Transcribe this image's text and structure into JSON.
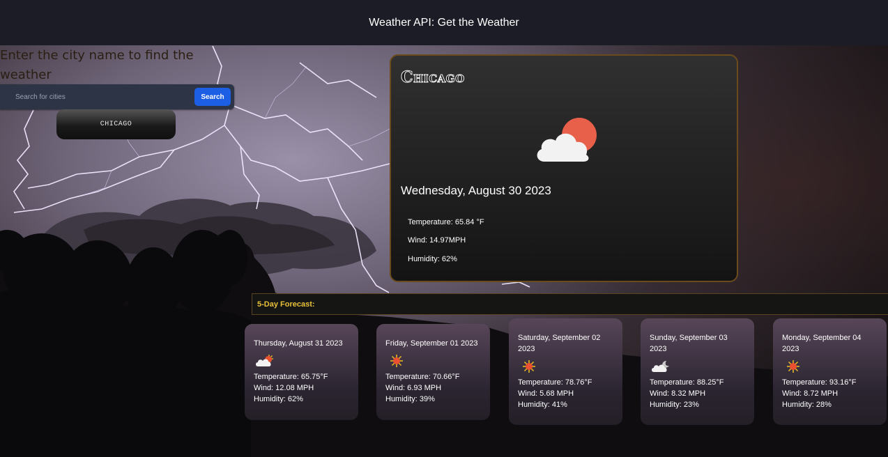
{
  "header": {
    "title": "Weather API: Get the Weather"
  },
  "search": {
    "prompt": "Enter the city name to find the weather",
    "placeholder": "Search for cities",
    "button_label": "Search",
    "history": [
      "CHICAGO"
    ]
  },
  "current": {
    "city": "Chicago",
    "icon": "partly-cloudy-icon",
    "date": "Wednesday, August 30 2023",
    "temperature": "Temperature: 65.84 °F",
    "wind": "Wind: 14.97MPH",
    "humidity": "Humidity: 62%"
  },
  "forecast": {
    "title": "5-Day Forecast:",
    "days": [
      {
        "date": "Thursday, August 31 2023",
        "icon": "few-clouds-icon",
        "temperature": "Temperature: 65.75°F",
        "wind": "Wind: 12.08 MPH",
        "humidity": "Humidity: 62%"
      },
      {
        "date": "Friday, September 01 2023",
        "icon": "clear-sun-icon",
        "temperature": "Temperature: 70.66°F",
        "wind": "Wind: 6.93 MPH",
        "humidity": "Humidity: 39%"
      },
      {
        "date": "Saturday, September 02 2023",
        "icon": "clear-sun-icon",
        "temperature": "Temperature: 78.76°F",
        "wind": "Wind: 5.68 MPH",
        "humidity": "Humidity: 41%"
      },
      {
        "date": "Sunday, September 03 2023",
        "icon": "night-cloud-icon",
        "temperature": "Temperature: 88.25°F",
        "wind": "Wind: 8.32 MPH",
        "humidity": "Humidity: 23%"
      },
      {
        "date": "Monday, September 04 2023",
        "icon": "clear-sun-icon",
        "temperature": "Temperature: 93.16°F",
        "wind": "Wind: 8.72 MPH",
        "humidity": "Humidity: 28%"
      }
    ]
  },
  "colors": {
    "header_bg": "#1c1c26",
    "search_button": "#1d5fe4",
    "forecast_title": "#e8c13a",
    "sun": "#e8604a"
  }
}
